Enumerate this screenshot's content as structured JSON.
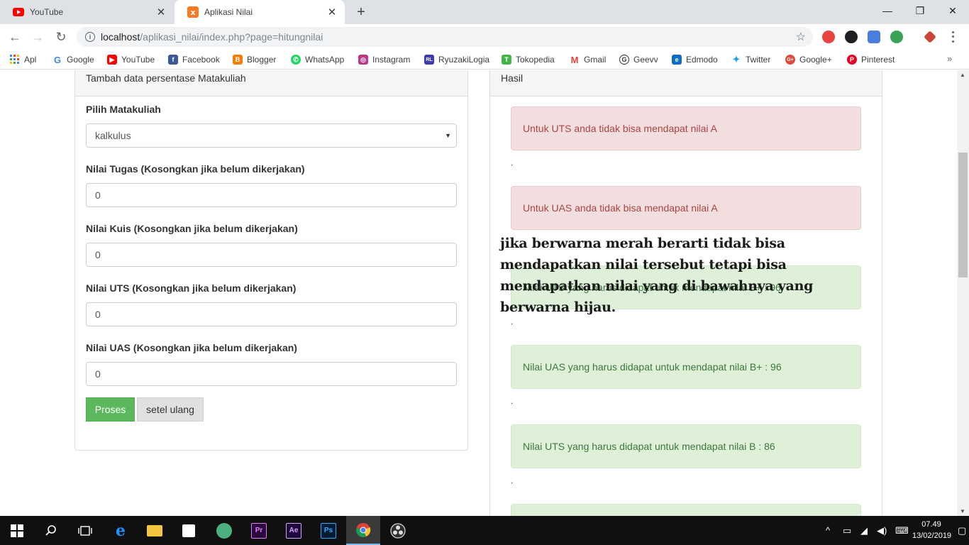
{
  "browser": {
    "tabs": [
      {
        "label": "YouTube",
        "active": false
      },
      {
        "label": "Aplikasi Nilai",
        "active": true
      }
    ],
    "url_host": "localhost",
    "url_path": "/aplikasi_nilai/index.php?page=hitungnilai",
    "bookmarks": [
      {
        "label": "Apl",
        "icon": "apps-grid-icon"
      },
      {
        "label": "Google",
        "icon": "google-icon"
      },
      {
        "label": "YouTube",
        "icon": "youtube-icon"
      },
      {
        "label": "Facebook",
        "icon": "facebook-icon"
      },
      {
        "label": "Blogger",
        "icon": "blogger-icon"
      },
      {
        "label": "WhatsApp",
        "icon": "whatsapp-icon"
      },
      {
        "label": "Instagram",
        "icon": "instagram-icon"
      },
      {
        "label": "RyuzakiLogia",
        "icon": "ryuzakilogia-icon"
      },
      {
        "label": "Tokopedia",
        "icon": "tokopedia-icon"
      },
      {
        "label": "Gmail",
        "icon": "gmail-icon"
      },
      {
        "label": "Geevv",
        "icon": "geevv-icon"
      },
      {
        "label": "Edmodo",
        "icon": "edmodo-icon"
      },
      {
        "label": "Twitter",
        "icon": "twitter-icon"
      },
      {
        "label": "Google+",
        "icon": "google-plus-icon"
      },
      {
        "label": "Pinterest",
        "icon": "pinterest-icon"
      }
    ],
    "more_bookmarks": "»"
  },
  "form_panel": {
    "heading": "Tambah data persentase Matakuliah",
    "subject_label": "Pilih Matakuliah",
    "subject_value": "kalkulus",
    "fields": [
      {
        "label": "Nilai Tugas (Kosongkan jika belum dikerjakan)",
        "value": "0"
      },
      {
        "label": "Nilai Kuis (Kosongkan jika belum dikerjakan)",
        "value": "0"
      },
      {
        "label": "Nilai UTS (Kosongkan jika belum dikerjakan)",
        "value": "0"
      },
      {
        "label": "Nilai UAS (Kosongkan jika belum dikerjakan)",
        "value": "0"
      }
    ],
    "submit_label": "Proses",
    "reset_label": "setel ulang"
  },
  "result_panel": {
    "heading": "Hasil",
    "alerts": [
      {
        "type": "danger",
        "text": "Untuk UTS anda tidak bisa mendapat nilai A"
      },
      {
        "type": "danger",
        "text": "Untuk UAS anda tidak bisa mendapat nilai A"
      },
      {
        "type": "success",
        "text": "Nilai UTS yang harus didapat untuk mendapat nilai B+ : 96"
      },
      {
        "type": "success",
        "text": "Nilai UAS yang harus didapat untuk mendapat nilai B+ : 96"
      },
      {
        "type": "success",
        "text": "Nilai UTS yang harus didapat untuk mendapat nilai B : 86"
      }
    ],
    "separator": "."
  },
  "overlay_caption": "jika berwarna merah berarti tidak bisa mendapatkan nilai tersebut tetapi bisa mendapatkan nilai yang di bawahnya yang berwarna hijau.",
  "taskbar": {
    "apps": [
      "windows-start-icon",
      "search-icon",
      "task-view-icon",
      "edge-icon",
      "file-explorer-icon",
      "store-icon",
      "app-green-icon",
      "premiere-icon",
      "after-effects-icon",
      "photoshop-icon",
      "chrome-icon",
      "obs-icon"
    ],
    "time": "07.49",
    "date": "13/02/2019"
  },
  "colors": {
    "success_button": "#5cb85c",
    "alert_danger_bg": "#f2dede",
    "alert_success_bg": "#dff0d8"
  }
}
